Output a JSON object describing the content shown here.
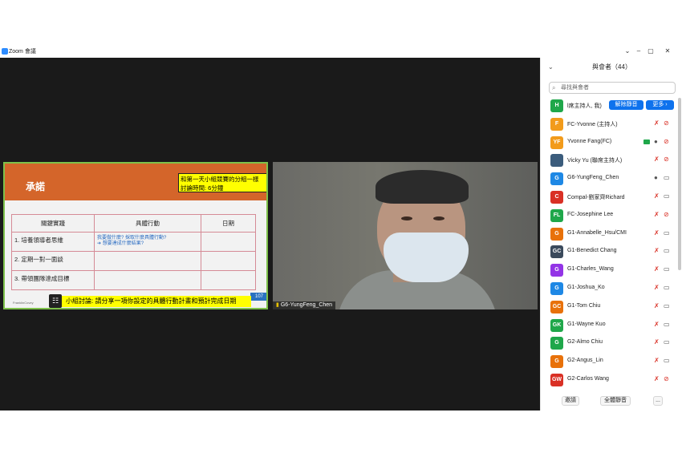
{
  "window": {
    "title": "Zoom 會議",
    "controls": [
      "⌄",
      "–",
      "▢",
      "✕"
    ]
  },
  "slide": {
    "title": "承諾",
    "note_line1": "和第一天小組競賽的分組一樣",
    "note_line2": "討論時間: 6分鐘",
    "headers": [
      "關鍵實踐",
      "具體行動",
      "日期"
    ],
    "rows": [
      {
        "practice": "1. 培養領導者思維",
        "action_line1": "我要做什麼? 採取什麼具體行動?",
        "action_line2": "➔ 想要達成什麼結果?",
        "date": ""
      },
      {
        "practice": "2. 定期一對一面談",
        "action_line1": "",
        "action_line2": "",
        "date": ""
      },
      {
        "practice": "3. 帶領團隊達成目標",
        "action_line1": "",
        "action_line2": "",
        "date": ""
      }
    ],
    "page_number": "107",
    "bottom_text": "小組討論: 請分享一項你設定的具體行動計畫和預計完成日期",
    "tiny_logo": "FranklinCovey"
  },
  "video": {
    "name": "G6-YungFeng_Chen"
  },
  "participants_panel": {
    "title": "與會者（44）",
    "search_placeholder": "尋找與會者",
    "host_row": {
      "name": "l席主持人, 我)",
      "unmute_label": "解除靜音",
      "more_label": "更多 ›"
    },
    "participants": [
      {
        "initials": "F",
        "color": "#f29b1b",
        "name": "FC-Yvonne (主持人)",
        "mic_muted": true,
        "cam_off": true,
        "sharing": false
      },
      {
        "initials": "YF",
        "color": "#f29b1b",
        "name": "Yvonne Fang(FC)",
        "mic_muted": false,
        "cam_off": true,
        "sharing": true
      },
      {
        "initials": "",
        "color": "#3b5c7c",
        "name": "Vicky Yu (聯席主持人)",
        "mic_muted": true,
        "cam_off": true,
        "sharing": false
      },
      {
        "initials": "G",
        "color": "#1e88e5",
        "name": "G6-YungFeng_Chen",
        "mic_muted": false,
        "cam_off": false,
        "sharing": false
      },
      {
        "initials": "C",
        "color": "#d93025",
        "name": "Compal-劉家齊Richard",
        "mic_muted": true,
        "cam_off": false,
        "sharing": false
      },
      {
        "initials": "FL",
        "color": "#1fa74a",
        "name": "FC-Josephine Lee",
        "mic_muted": true,
        "cam_off": true,
        "sharing": false
      },
      {
        "initials": "G",
        "color": "#e8710a",
        "name": "G1-Annabelle_Hsu/CMI",
        "mic_muted": true,
        "cam_off": false,
        "sharing": false
      },
      {
        "initials": "GC",
        "color": "#3b4a5c",
        "name": "G1-Benedict Chang",
        "mic_muted": true,
        "cam_off": false,
        "sharing": false
      },
      {
        "initials": "G",
        "color": "#9334e6",
        "name": "G1-Charles_Wang",
        "mic_muted": true,
        "cam_off": false,
        "sharing": false
      },
      {
        "initials": "G",
        "color": "#1e88e5",
        "name": "G1-Joshua_Ko",
        "mic_muted": true,
        "cam_off": false,
        "sharing": false
      },
      {
        "initials": "GC",
        "color": "#e8710a",
        "name": "G1-Tom Chiu",
        "mic_muted": true,
        "cam_off": false,
        "sharing": false
      },
      {
        "initials": "GK",
        "color": "#1fa74a",
        "name": "G1-Wayne Kuo",
        "mic_muted": true,
        "cam_off": false,
        "sharing": false
      },
      {
        "initials": "G",
        "color": "#1fa74a",
        "name": "G2-Almo Chiu",
        "mic_muted": true,
        "cam_off": false,
        "sharing": false
      },
      {
        "initials": "G",
        "color": "#e8710a",
        "name": "G2-Angus_Lin",
        "mic_muted": true,
        "cam_off": false,
        "sharing": false
      },
      {
        "initials": "GW",
        "color": "#d93025",
        "name": "G2-Carlos Wang",
        "mic_muted": true,
        "cam_off": true,
        "sharing": false
      }
    ],
    "footer": {
      "invite_label": "邀請",
      "mute_all_label": "全體靜音",
      "more_label": "..."
    }
  }
}
